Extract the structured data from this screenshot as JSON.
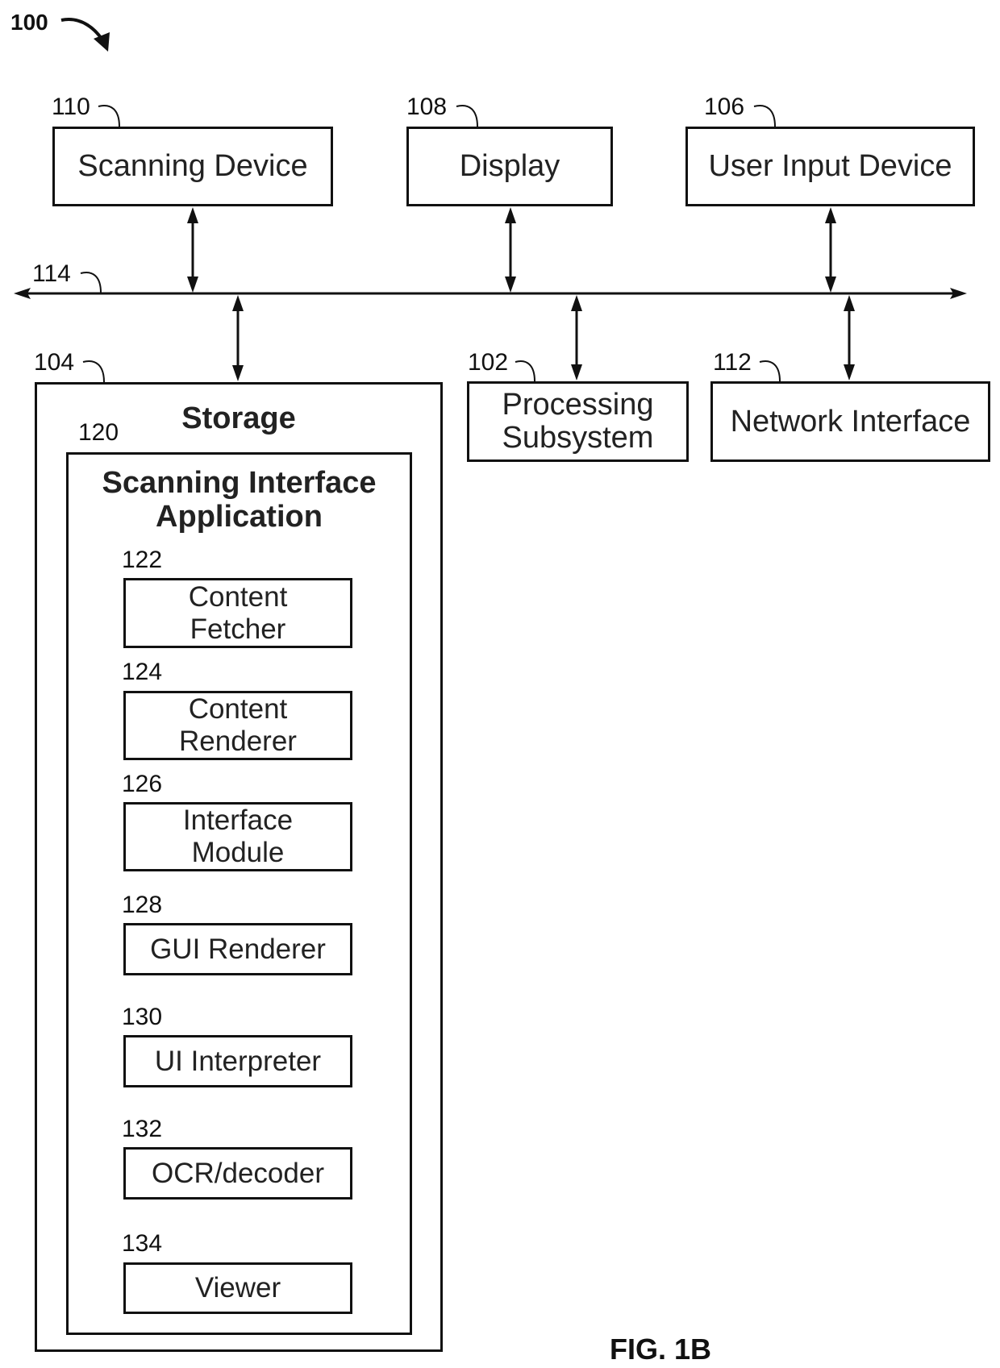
{
  "diagram_id": "100",
  "figure_label": "FIG. 1B",
  "bus": {
    "ref": "114"
  },
  "top_components": [
    {
      "ref": "110",
      "label": "Scanning Device"
    },
    {
      "ref": "108",
      "label": "Display"
    },
    {
      "ref": "106",
      "label": "User Input Device"
    }
  ],
  "bottom_components": [
    {
      "ref": "102",
      "label_lines": [
        "Processing",
        "Subsystem"
      ]
    },
    {
      "ref": "112",
      "label": "Network Interface"
    }
  ],
  "storage": {
    "ref": "104",
    "title": "Storage",
    "application": {
      "ref": "120",
      "title_lines": [
        "Scanning Interface",
        "Application"
      ],
      "modules": [
        {
          "ref": "122",
          "label_lines": [
            "Content",
            "Fetcher"
          ]
        },
        {
          "ref": "124",
          "label_lines": [
            "Content",
            "Renderer"
          ]
        },
        {
          "ref": "126",
          "label_lines": [
            "Interface",
            "Module"
          ]
        },
        {
          "ref": "128",
          "label_lines": [
            "GUI Renderer"
          ]
        },
        {
          "ref": "130",
          "label_lines": [
            "UI Interpreter"
          ]
        },
        {
          "ref": "132",
          "label_lines": [
            "OCR/decoder"
          ]
        },
        {
          "ref": "134",
          "label_lines": [
            "Viewer"
          ]
        }
      ]
    }
  }
}
